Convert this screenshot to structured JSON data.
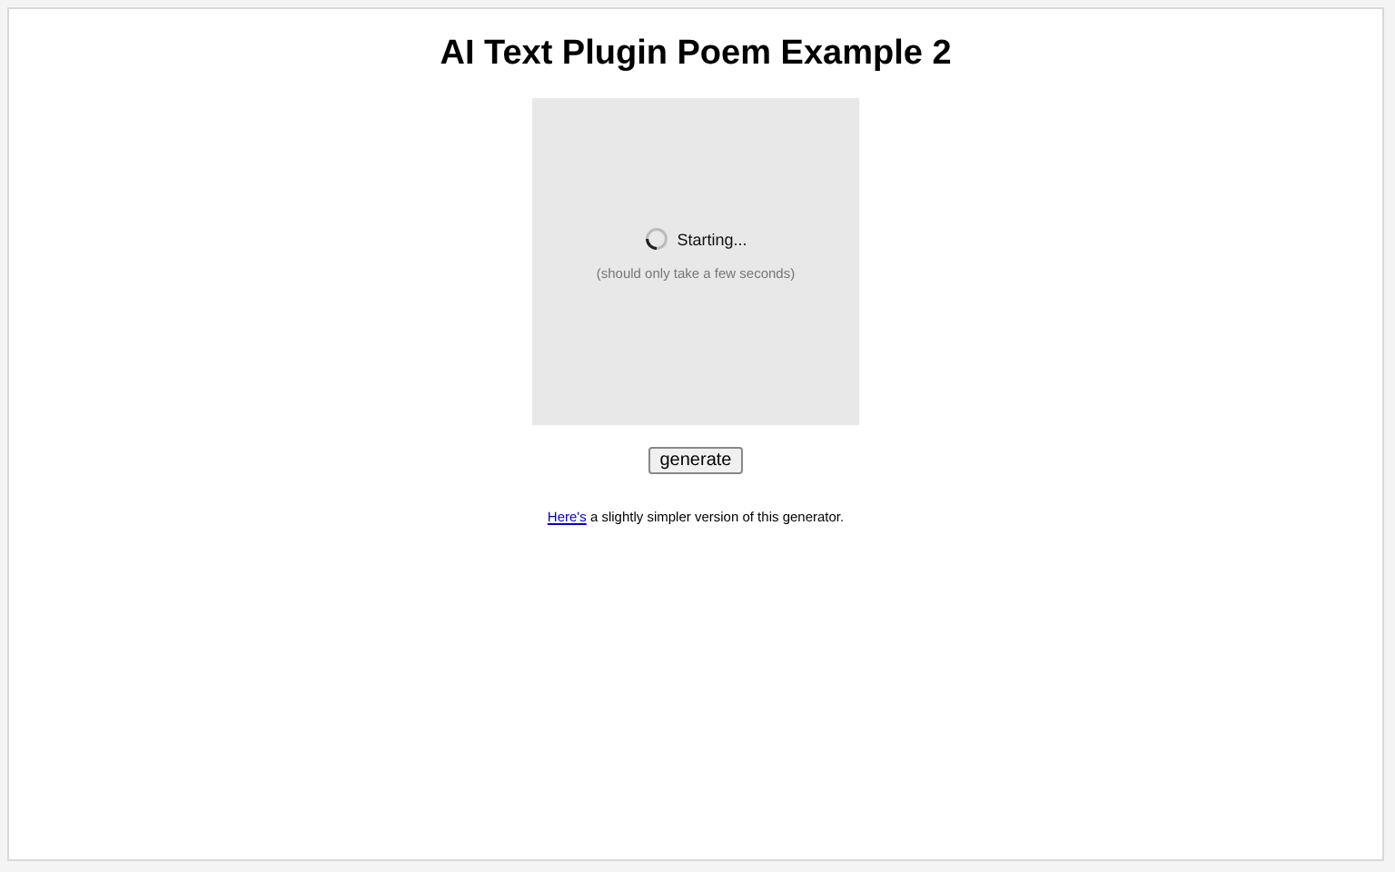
{
  "title": "AI Text Plugin Poem Example 2",
  "output": {
    "status": "Starting...",
    "hint": "(should only take a few seconds)"
  },
  "button": "generate",
  "footer": {
    "link": "Here's",
    "text": " a slightly simpler version of this generator."
  }
}
